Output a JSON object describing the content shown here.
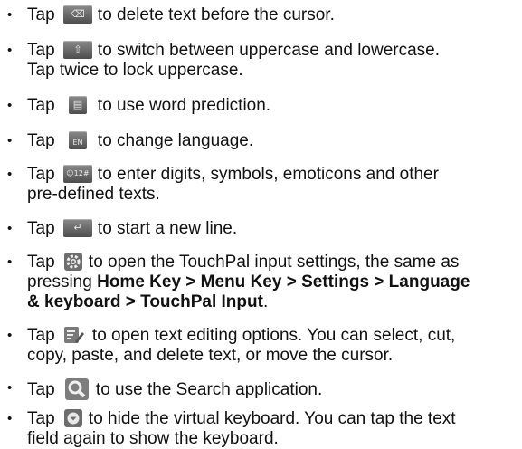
{
  "items": [
    {
      "pre": "Tap",
      "icon": "backspace-key-icon",
      "text": "to delete text before the cursor."
    },
    {
      "pre": "Tap",
      "icon": "shift-key-icon",
      "text": "to switch between uppercase and lowercase.",
      "cont": "Tap twice to lock uppercase."
    },
    {
      "pre": "Tap",
      "icon": "word-prediction-key-icon",
      "text": "to use word prediction."
    },
    {
      "pre": "Tap",
      "icon": "language-key-icon",
      "icon_label": "EN",
      "text": "to change language."
    },
    {
      "pre": "Tap",
      "icon": "symbols-key-icon",
      "icon_label": "☺12#",
      "text": "to enter digits, symbols, emoticons and other",
      "cont": "pre-defined texts."
    },
    {
      "pre": "Tap",
      "icon": "enter-key-icon",
      "text": "to start a new line."
    },
    {
      "pre": "Tap",
      "icon": "gear-icon",
      "text": "to open the TouchPal input settings, the same as",
      "cont_a": "pressing ",
      "cont_bold": "Home Key > Menu Key > Settings > Language",
      "cont_bold2": "& keyboard > TouchPal Input",
      "cont_end": "."
    },
    {
      "pre": "Tap",
      "icon": "edit-text-icon",
      "text": "to open text editing options. You can select, cut,",
      "cont": "copy, paste, and delete text, or move the cursor."
    },
    {
      "pre": "Tap",
      "icon": "search-icon",
      "text": "to use the Search application."
    },
    {
      "pre": "Tap",
      "icon": "hide-keyboard-icon",
      "text": "to hide the virtual keyboard. You can tap the text",
      "cont": "field again to show the keyboard."
    }
  ],
  "bullet": "•"
}
